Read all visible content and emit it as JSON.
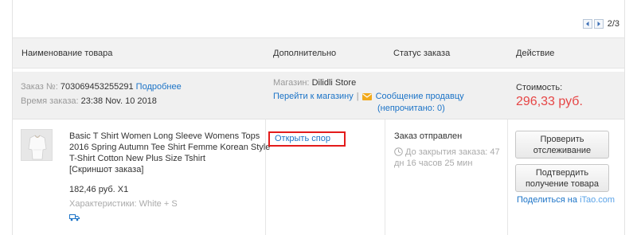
{
  "pager": {
    "page_text": "2/3"
  },
  "table_header": {
    "product": "Наименование товара",
    "extra": "Дополнительно",
    "status": "Статус заказа",
    "action": "Действие"
  },
  "order": {
    "order_no_label": "Заказ №:",
    "order_no": "703069453255291",
    "details_link": "Подробнее",
    "time_label": "Время заказа:",
    "time_value": "23:38 Nov. 10 2018",
    "store_label": "Магазин:",
    "store_name": "Dilidli Store",
    "go_store": "Перейти к магазину",
    "message_seller_line1": "Сообщение продавцу",
    "message_seller_line2": "(непрочитано: 0)",
    "cost_label": "Стоимость:",
    "cost_value": "296,33 руб."
  },
  "item": {
    "title": "Basic T Shirt Women Long Sleeve Womens Tops 2016 Spring Autumn Tee Shirt Femme Korean Style T-Shirt Cotton New Plus Size Tshirt",
    "snapshot": "[Скриншот заказа]",
    "price_qty": "182,46 руб. X1",
    "characteristics": "Характеристики: White + S",
    "dispute_label": "Открыть спор",
    "status_title": "Заказ отправлен",
    "status_countdown": "До закрытия заказа: 47 дн 16 часов 25 мин",
    "btn_track_line1": "Проверить",
    "btn_track_line2": "отслеживание",
    "btn_confirm_line1": "Подтвердить",
    "btn_confirm_line2": "получение товара",
    "share_prefix": "Поделиться на",
    "share_brand": "iTao.com"
  },
  "colors": {
    "price": "#e64545",
    "link": "#1b73c7",
    "dispute_border": "#e31b1b"
  },
  "icons": [
    "chevron-left-icon",
    "chevron-right-icon",
    "mail-icon",
    "clock-icon",
    "truck-icon"
  ]
}
